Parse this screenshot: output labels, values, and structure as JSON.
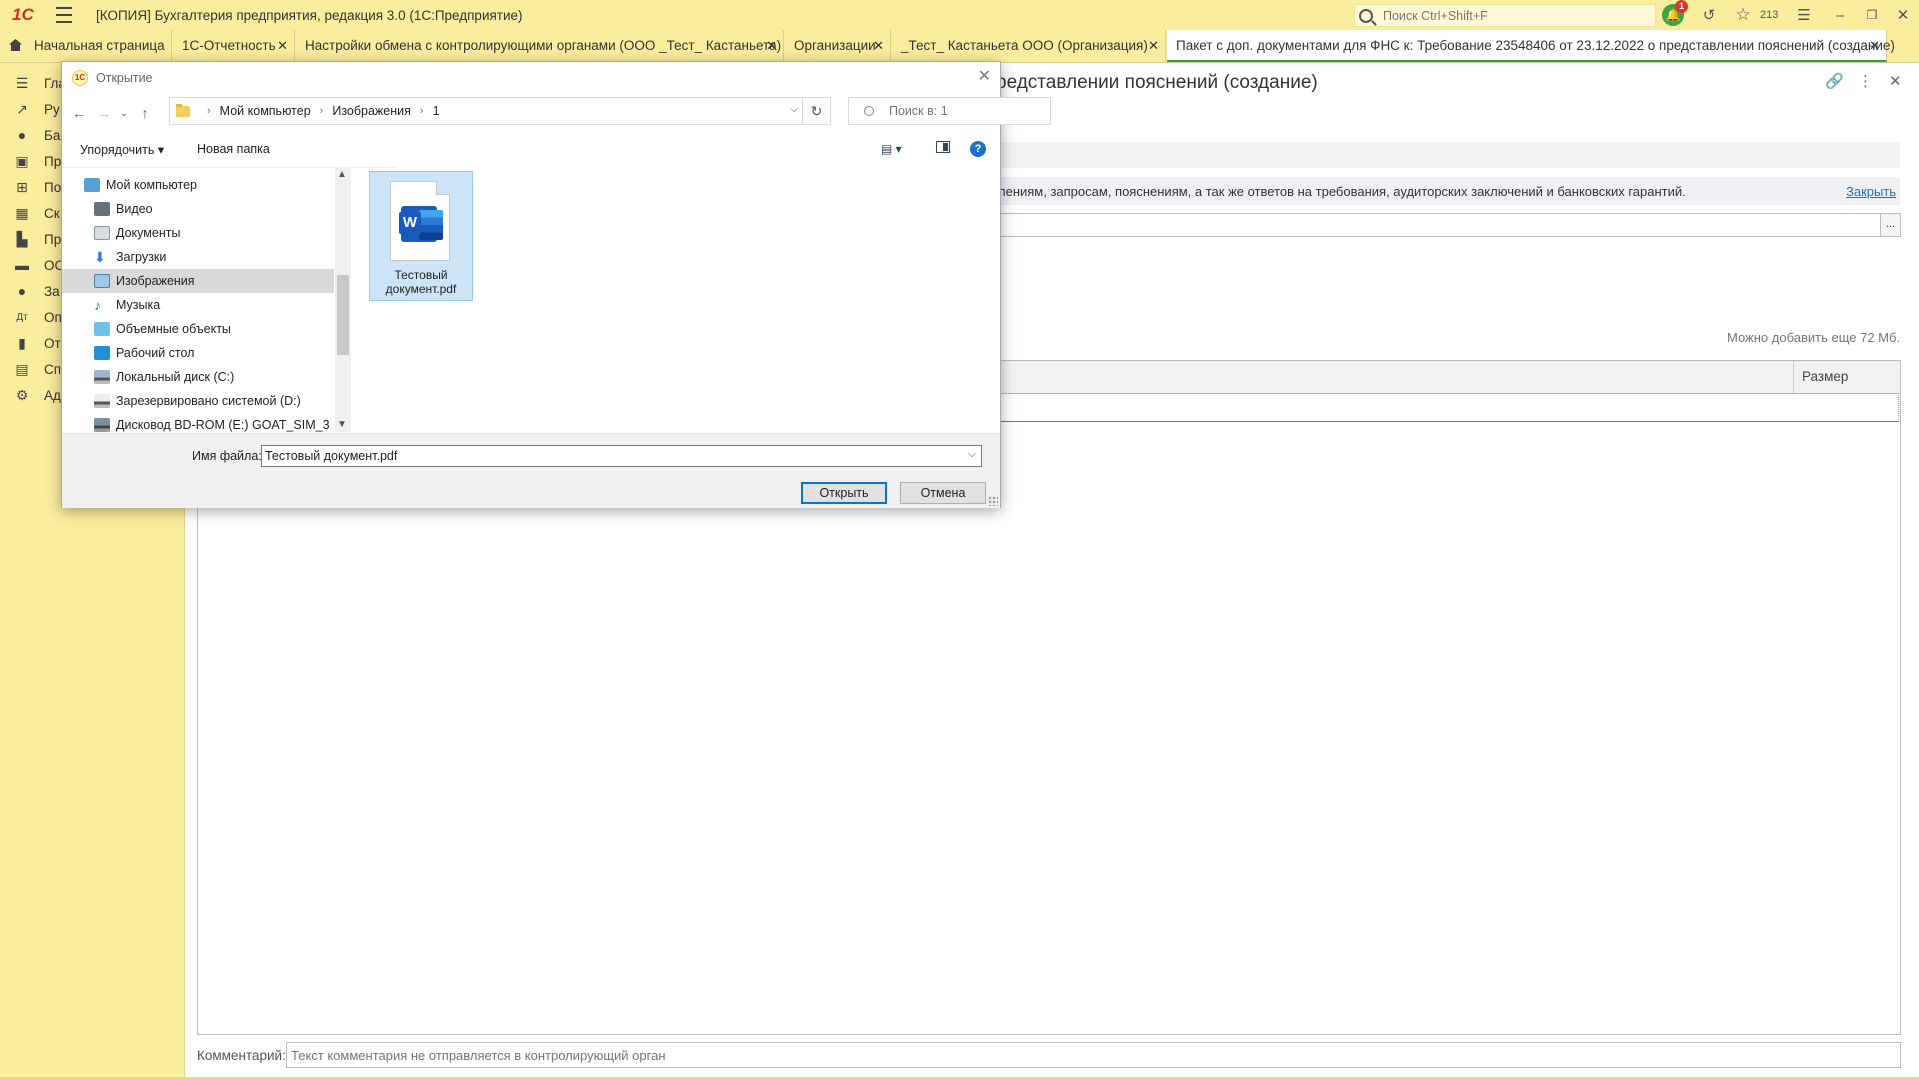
{
  "app": {
    "logo": "1С",
    "window_title": "[КОПИЯ] Бухгалтерия предприятия, редакция 3.0  (1С:Предприятие)",
    "search_placeholder": "Поиск Ctrl+Shift+F",
    "notifications_count": "1",
    "history_count": "213",
    "window_controls": [
      "minimize-icon",
      "restore-icon",
      "close-icon"
    ]
  },
  "tabs": [
    {
      "label": "Начальная страница",
      "closable": false
    },
    {
      "label": "1С-Отчетность",
      "closable": true
    },
    {
      "label": "Настройки обмена с контролирующими органами (ООО _Тест_ Кастаньета)",
      "closable": true
    },
    {
      "label": "Организации",
      "closable": true
    },
    {
      "label": "_Тест_ Кастаньета ООО (Организация)",
      "closable": true
    },
    {
      "label": "Пакет с доп. документами для ФНС к: Требование 23548406 от 23.12.2022 о представлении пояснений (создание)",
      "closable": true
    }
  ],
  "sidebar": {
    "items": [
      {
        "label": "Гла",
        "icon": "menu-icon"
      },
      {
        "label": "Ру",
        "icon": "trend-icon"
      },
      {
        "label": "Ба",
        "icon": "bank-icon"
      },
      {
        "label": "Пр",
        "icon": "sales-icon"
      },
      {
        "label": "По",
        "icon": "cart-icon"
      },
      {
        "label": "Ск",
        "icon": "warehouse-icon"
      },
      {
        "label": "Пр",
        "icon": "production-icon"
      },
      {
        "label": "ОС",
        "icon": "truck-icon"
      },
      {
        "label": "За",
        "icon": "person-icon"
      },
      {
        "label": "Оп",
        "icon": "operations-icon"
      },
      {
        "label": "От",
        "icon": "reports-icon"
      },
      {
        "label": "Сп",
        "icon": "catalogs-icon"
      },
      {
        "label": "Ад",
        "icon": "gear-icon"
      }
    ]
  },
  "form": {
    "title_visible": "редставлении пояснений (создание)",
    "info_text": "лениям, запросам, пояснениям, а так же ответов на требования, аудиторских заключений и банковских гарантий.",
    "close_link": "Закрыть",
    "field_button": "...",
    "can_add_text": "Можно добавить еще 72 Мб.",
    "table_columns": [
      "Размер"
    ],
    "comment_label": "Комментарий:",
    "comment_placeholder": "Текст комментария не отправляется в контролирующий орган"
  },
  "dialog": {
    "title": "Открытие",
    "breadcrumb": [
      "Мой компьютер",
      "Изображения",
      "1"
    ],
    "search_placeholder": "Поиск в: 1",
    "organize_label": "Упорядочить",
    "new_folder_label": "Новая папка",
    "tree": [
      {
        "label": "Мой компьютер",
        "icon": "computer-icon",
        "indent": 0,
        "selected": false
      },
      {
        "label": "Видео",
        "icon": "video-icon",
        "indent": 1,
        "selected": false
      },
      {
        "label": "Документы",
        "icon": "documents-icon",
        "indent": 1,
        "selected": false
      },
      {
        "label": "Загрузки",
        "icon": "downloads-icon",
        "indent": 1,
        "selected": false
      },
      {
        "label": "Изображения",
        "icon": "pictures-icon",
        "indent": 1,
        "selected": true
      },
      {
        "label": "Музыка",
        "icon": "music-icon",
        "indent": 1,
        "selected": false
      },
      {
        "label": "Объемные объекты",
        "icon": "3d-objects-icon",
        "indent": 1,
        "selected": false
      },
      {
        "label": "Рабочий стол",
        "icon": "desktop-icon",
        "indent": 1,
        "selected": false
      },
      {
        "label": "Локальный диск (C:)",
        "icon": "drive-icon",
        "indent": 1,
        "selected": false
      },
      {
        "label": "Зарезервировано системой (D:)",
        "icon": "drive-icon",
        "indent": 1,
        "selected": false
      },
      {
        "label": "Дисковод BD-ROM (E:) GOAT_SIM_3",
        "icon": "optical-drive-icon",
        "indent": 1,
        "selected": false
      }
    ],
    "files": [
      {
        "name": "Тестовый документ.pdf",
        "icon": "word-document-icon",
        "selected": true
      }
    ],
    "filename_label": "Имя файла:",
    "filename_value": "Тестовый документ.pdf",
    "open_button": "Открыть",
    "cancel_button": "Отмена"
  },
  "colors": {
    "chrome": "#fbed9e",
    "active_tab_accent": "#3a9a48",
    "link": "#2a6fb5",
    "selection": "#cce4f7",
    "primary_button_border": "#0078d7"
  }
}
